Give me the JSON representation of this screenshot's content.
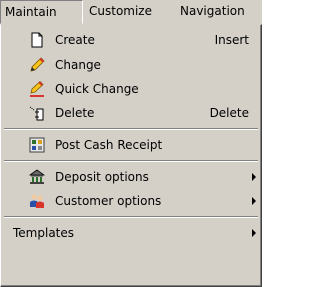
{
  "menubar": {
    "items": [
      {
        "label": "Maintain",
        "active": true
      },
      {
        "label": "Customize"
      },
      {
        "label": "Navigation"
      }
    ]
  },
  "dropdown": {
    "items": [
      {
        "label": "Create",
        "shortcut": "Insert",
        "icon": "new-document-icon"
      },
      {
        "label": "Change",
        "icon": "pencil-icon"
      },
      {
        "label": "Quick Change",
        "icon": "quick-change-pencil-icon"
      },
      {
        "label": "Delete",
        "shortcut": "Delete",
        "icon": "delete-icon"
      },
      {
        "label": "Post Cash Receipt",
        "icon": "cash-receipt-icon"
      },
      {
        "label": "Deposit options",
        "icon": "bank-icon",
        "submenu": true
      },
      {
        "label": "Customer options",
        "icon": "customers-icon",
        "submenu": true
      },
      {
        "label": "Templates",
        "submenu": true
      }
    ]
  }
}
